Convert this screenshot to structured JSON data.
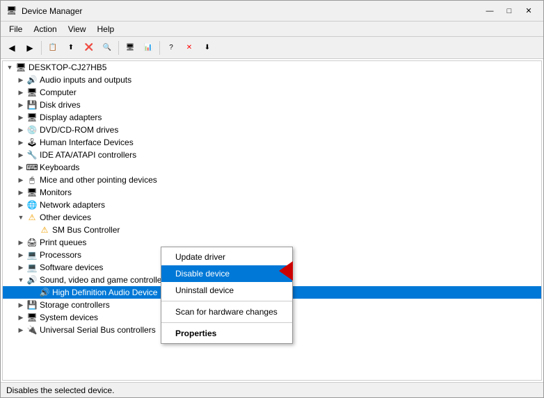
{
  "window": {
    "title": "Device Manager",
    "icon": "💻"
  },
  "titlebar": {
    "minimize_label": "—",
    "maximize_label": "□",
    "close_label": "✕"
  },
  "menubar": {
    "items": [
      {
        "label": "File"
      },
      {
        "label": "Action"
      },
      {
        "label": "View"
      },
      {
        "label": "Help"
      }
    ]
  },
  "tree": {
    "root": {
      "label": "DESKTOP-CJ27HB5",
      "expanded": true
    },
    "items": [
      {
        "indent": 1,
        "expand": "▶",
        "icon": "🔊",
        "label": "Audio inputs and outputs",
        "expanded": false
      },
      {
        "indent": 1,
        "expand": "▶",
        "icon": "🖥",
        "label": "Computer",
        "expanded": false
      },
      {
        "indent": 1,
        "expand": "▶",
        "icon": "💾",
        "label": "Disk drives",
        "expanded": false
      },
      {
        "indent": 1,
        "expand": "▶",
        "icon": "🖥",
        "label": "Display adapters",
        "expanded": false
      },
      {
        "indent": 1,
        "expand": "▶",
        "icon": "💿",
        "label": "DVD/CD-ROM drives",
        "expanded": false
      },
      {
        "indent": 1,
        "expand": "▶",
        "icon": "🖱",
        "label": "Human Interface Devices",
        "expanded": false
      },
      {
        "indent": 1,
        "expand": "▶",
        "icon": "🔧",
        "label": "IDE ATA/ATAPI controllers",
        "expanded": false
      },
      {
        "indent": 1,
        "expand": "▶",
        "icon": "⌨",
        "label": "Keyboards",
        "expanded": false
      },
      {
        "indent": 1,
        "expand": "▶",
        "icon": "🖱",
        "label": "Mice and other pointing devices",
        "expanded": false
      },
      {
        "indent": 1,
        "expand": "▶",
        "icon": "🖥",
        "label": "Monitors",
        "expanded": false
      },
      {
        "indent": 1,
        "expand": "▶",
        "icon": "🌐",
        "label": "Network adapters",
        "expanded": false
      },
      {
        "indent": 1,
        "expand": "▼",
        "icon": "⚠",
        "label": "Other devices",
        "expanded": true
      },
      {
        "indent": 2,
        "expand": " ",
        "icon": "🔧",
        "label": "SM Bus Controller",
        "expanded": false
      },
      {
        "indent": 1,
        "expand": "▶",
        "icon": "🖨",
        "label": "Print queues",
        "expanded": false
      },
      {
        "indent": 1,
        "expand": "▶",
        "icon": "💻",
        "label": "Processors",
        "expanded": false
      },
      {
        "indent": 1,
        "expand": "▶",
        "icon": "💻",
        "label": "Software devices",
        "expanded": false
      },
      {
        "indent": 1,
        "expand": "▼",
        "icon": "🔊",
        "label": "Sound, video and game controllers",
        "expanded": true
      },
      {
        "indent": 2,
        "expand": " ",
        "icon": "🔊",
        "label": "High Definition Audio Device",
        "selected": true
      },
      {
        "indent": 1,
        "expand": "▶",
        "icon": "💾",
        "label": "Storage controllers",
        "expanded": false
      },
      {
        "indent": 1,
        "expand": "▶",
        "icon": "🖥",
        "label": "System devices",
        "expanded": false
      },
      {
        "indent": 1,
        "expand": "▶",
        "icon": "🔌",
        "label": "Universal Serial Bus controllers",
        "expanded": false
      }
    ]
  },
  "context_menu": {
    "items": [
      {
        "label": "Update driver",
        "bold": false,
        "separator_after": false
      },
      {
        "label": "Disable device",
        "bold": false,
        "separator_after": false
      },
      {
        "label": "Uninstall device",
        "bold": false,
        "separator_after": true
      },
      {
        "label": "Scan for hardware changes",
        "bold": false,
        "separator_after": true
      },
      {
        "label": "Properties",
        "bold": true,
        "separator_after": false
      }
    ]
  },
  "status_bar": {
    "text": "Disables the selected device."
  },
  "toolbar": {
    "buttons": [
      "←",
      "→",
      "☰",
      "⊕",
      "?",
      "📋",
      "🖥",
      "⬛",
      "✕",
      "⬇"
    ]
  }
}
